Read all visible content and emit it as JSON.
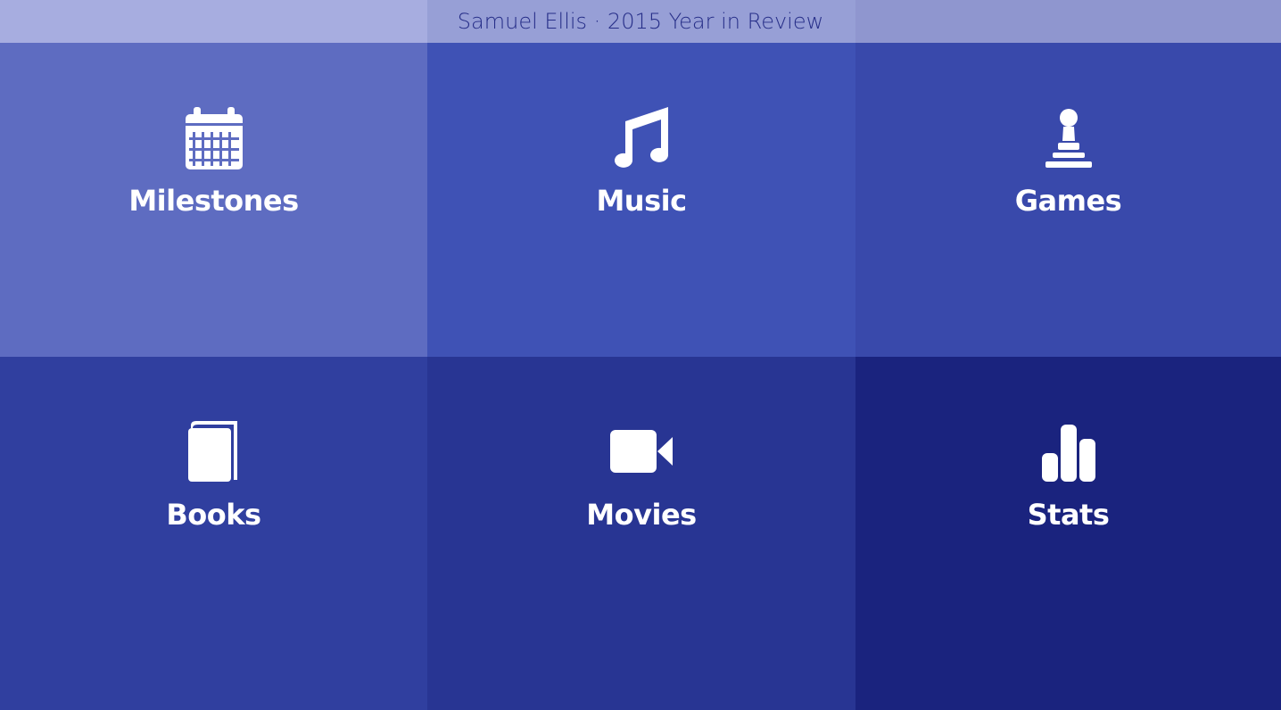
{
  "header": {
    "title": "Samuel Ellis · 2015 Year in Review"
  },
  "tiles": [
    {
      "label": "Milestones",
      "icon": "calendar-icon",
      "color": "#5e6cc1"
    },
    {
      "label": "Music",
      "icon": "music-note-icon",
      "color": "#3f52b5"
    },
    {
      "label": "Games",
      "icon": "pawn-icon",
      "color": "#3949ab"
    },
    {
      "label": "Books",
      "icon": "book-icon",
      "color": "#303f9f"
    },
    {
      "label": "Movies",
      "icon": "video-camera-icon",
      "color": "#283593"
    },
    {
      "label": "Stats",
      "icon": "bar-chart-icon",
      "color": "#1a237e"
    }
  ]
}
